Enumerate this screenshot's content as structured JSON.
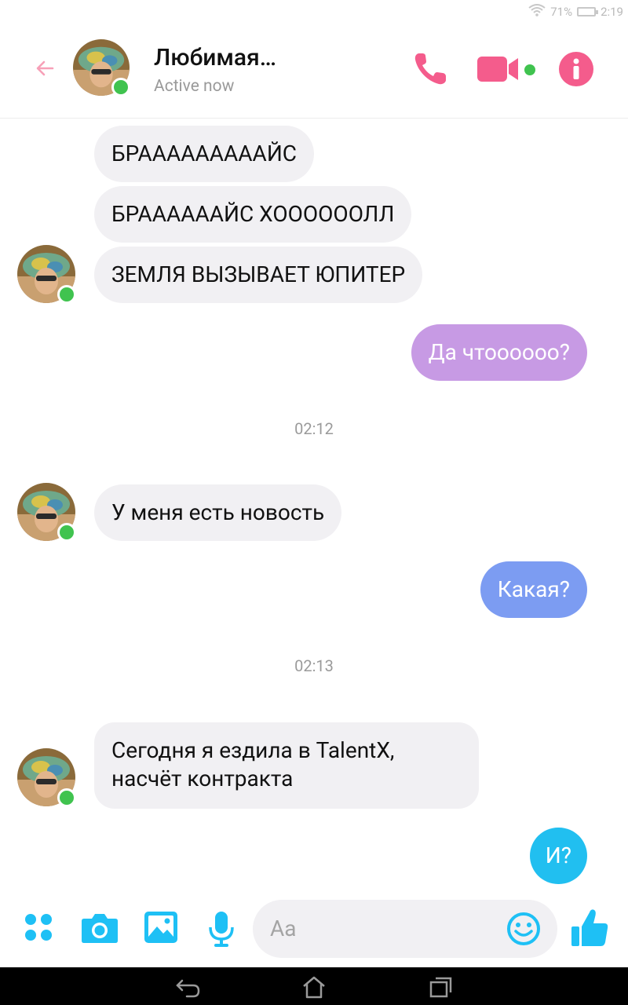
{
  "status_bar": {
    "battery": "71%",
    "time": "2:19"
  },
  "header": {
    "contact_name": "Любимая…",
    "status": "Active now"
  },
  "messages": [
    {
      "text": "БРАААААААААЙС"
    },
    {
      "text": "БРААААААЙС ХООООООЛЛ"
    },
    {
      "text": "ЗЕМЛЯ ВЫЗЫВАЕТ ЮПИТЕР"
    },
    {
      "text": "Да чтоооооо?"
    },
    {
      "text": "У меня есть новость"
    },
    {
      "text": "Какая?"
    },
    {
      "text": "Сегодня я ездила в TalentX,",
      "text2": "насчёт контракта"
    },
    {
      "text": "И?"
    }
  ],
  "timestamps": [
    "02:12",
    "02:13"
  ],
  "composer": {
    "placeholder": "Aa"
  },
  "colors": {
    "accent_header": "#f45c8c",
    "accent_composer": "#1ec0f5",
    "outgoing_purple": "#c79ae4",
    "outgoing_blue": "#7c9cf2",
    "outgoing_cyan": "#21bff0",
    "online": "#40c34f"
  },
  "icons": {
    "header": [
      "back-arrow-icon",
      "phone-icon",
      "video-camera-icon",
      "info-icon"
    ],
    "composer": [
      "apps-grid-icon",
      "camera-icon",
      "gallery-icon",
      "microphone-icon",
      "emoji-icon",
      "thumbs-up-icon"
    ],
    "nav": [
      "back-icon",
      "home-icon",
      "recents-icon"
    ]
  }
}
